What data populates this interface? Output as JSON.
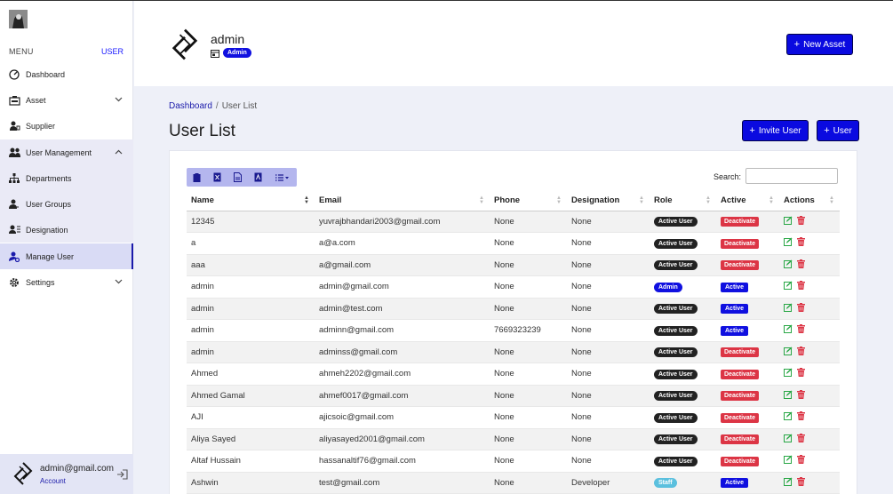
{
  "sidebar": {
    "menu_label": "MENU",
    "user_label": "USER",
    "items": [
      {
        "label": "Dashboard"
      },
      {
        "label": "Asset"
      },
      {
        "label": "Supplier"
      },
      {
        "label": "User Management"
      },
      {
        "label": "Departments"
      },
      {
        "label": "User Groups"
      },
      {
        "label": "Designation"
      },
      {
        "label": "Manage User"
      },
      {
        "label": "Settings"
      }
    ],
    "footer": {
      "email": "admin@gmail.com",
      "account": "Account"
    }
  },
  "header": {
    "name": "admin",
    "role_badge": "Admin",
    "new_asset_label": "New Asset"
  },
  "breadcrumb": {
    "root": "Dashboard",
    "separator": "/",
    "current": "User List"
  },
  "page": {
    "title": "User List",
    "invite_label": "Invite User",
    "user_label": "User"
  },
  "table": {
    "search_label": "Search:",
    "search_value": "",
    "columns": [
      "Name",
      "Email",
      "Phone",
      "Designation",
      "Role",
      "Active",
      "Actions"
    ],
    "rows": [
      {
        "name": "12345",
        "email": "yuvrajbhandari2003@gmail.com",
        "phone": "None",
        "designation": "None",
        "role": "Active User",
        "active": "Deactivate"
      },
      {
        "name": "a",
        "email": "a@a.com",
        "phone": "None",
        "designation": "None",
        "role": "Active User",
        "active": "Deactivate"
      },
      {
        "name": "aaa",
        "email": "a@gmail.com",
        "phone": "None",
        "designation": "None",
        "role": "Active User",
        "active": "Deactivate"
      },
      {
        "name": "admin",
        "email": "admin@gmail.com",
        "phone": "None",
        "designation": "None",
        "role": "Admin",
        "active": "Active"
      },
      {
        "name": "admin",
        "email": "admin@test.com",
        "phone": "None",
        "designation": "None",
        "role": "Active User",
        "active": "Active"
      },
      {
        "name": "admin",
        "email": "adminn@gmail.com",
        "phone": "7669323239",
        "designation": "None",
        "role": "Active User",
        "active": "Active"
      },
      {
        "name": "admin",
        "email": "adminss@gmail.com",
        "phone": "None",
        "designation": "None",
        "role": "Active User",
        "active": "Deactivate"
      },
      {
        "name": "Ahmed",
        "email": "ahmeh2202@gmail.com",
        "phone": "None",
        "designation": "None",
        "role": "Active User",
        "active": "Deactivate"
      },
      {
        "name": "Ahmed Gamal",
        "email": "ahmef0017@gmail.com",
        "phone": "None",
        "designation": "None",
        "role": "Active User",
        "active": "Deactivate"
      },
      {
        "name": "AJI",
        "email": "ajicsoic@gmail.com",
        "phone": "None",
        "designation": "None",
        "role": "Active User",
        "active": "Deactivate"
      },
      {
        "name": "Aliya Sayed",
        "email": "aliyasayed2001@gmail.com",
        "phone": "None",
        "designation": "None",
        "role": "Active User",
        "active": "Deactivate"
      },
      {
        "name": "Altaf Hussain",
        "email": "hassanaltif76@gmail.com",
        "phone": "None",
        "designation": "None",
        "role": "Active User",
        "active": "Deactivate"
      },
      {
        "name": "Ashwin",
        "email": "test@gmail.com",
        "phone": "None",
        "designation": "Developer",
        "role": "Staff",
        "active": "Active"
      }
    ]
  },
  "colors": {
    "accent": "#0a0ae0",
    "danger": "#dc3545",
    "success_icon": "#28a745",
    "sidebar_active_bg": "#d9dbf5"
  }
}
